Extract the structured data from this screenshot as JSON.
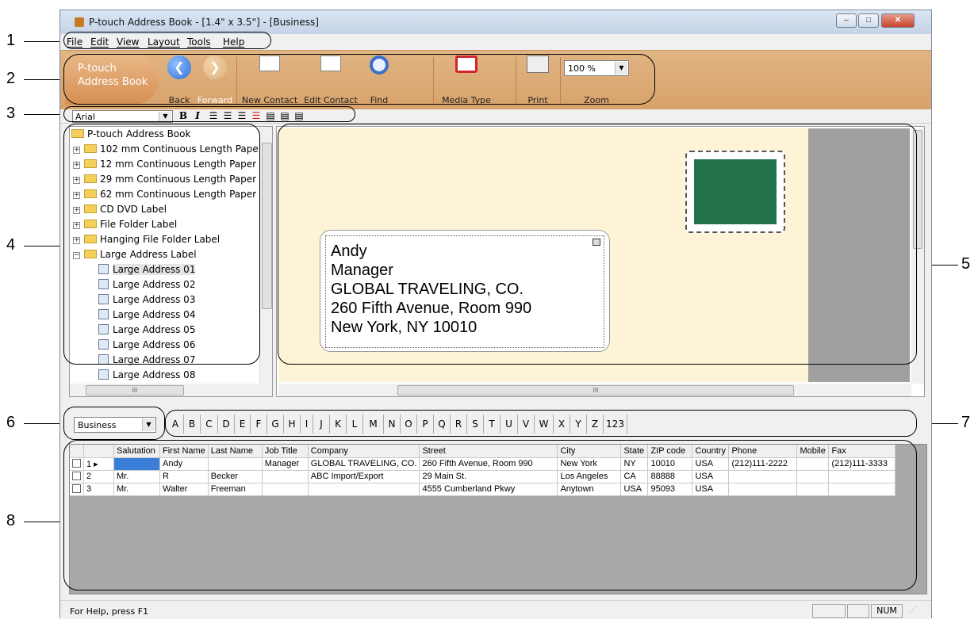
{
  "window": {
    "title": "P-touch Address Book - [1.4\" x 3.5\"] - [Business]",
    "controls": {
      "minimize": "‒",
      "maximize": "□",
      "close": "✕"
    }
  },
  "menu": [
    "File",
    "Edit",
    "View",
    "Layout",
    "Tools",
    "Help"
  ],
  "ribbon": {
    "brand_line1": "P-touch",
    "brand_line2": "Address Book",
    "back": "Back",
    "forward": "Forward",
    "new_contact": "New Contact",
    "edit_contact": "Edit Contact",
    "find": "Find",
    "media_type": "Media Type",
    "print": "Print",
    "zoom_label": "Zoom",
    "zoom_value": "100 %"
  },
  "format_bar": {
    "font": "Arial",
    "bold": "B",
    "italic": "I"
  },
  "tree": {
    "root": "P-touch Address Book",
    "folders": [
      "102 mm Continuous Length Pape",
      "12 mm Continuous Length Paper",
      "29 mm Continuous Length Paper",
      "62 mm Continuous Length Paper",
      "CD DVD Label",
      "File Folder Label",
      "Hanging File Folder Label",
      "Large Address Label"
    ],
    "items": [
      "Large Address 01",
      "Large Address 02",
      "Large Address 03",
      "Large Address 04",
      "Large Address 05",
      "Large Address 06",
      "Large Address 07",
      "Large Address 08"
    ],
    "scroll_grip": "III"
  },
  "preview": {
    "lines": [
      "Andy",
      "Manager",
      "GLOBAL TRAVELING, CO.",
      "260 Fifth Avenue, Room 990",
      "New York, NY  10010"
    ],
    "stamp_color": "#21714a",
    "scroll_grip": "III"
  },
  "group": "Business",
  "letters": [
    "A",
    "B",
    "C",
    "D",
    "E",
    "F",
    "G",
    "H",
    "I",
    "J",
    "K",
    "L",
    "M",
    "N",
    "O",
    "P",
    "Q",
    "R",
    "S",
    "T",
    "U",
    "V",
    "W",
    "X",
    "Y",
    "Z",
    "123"
  ],
  "table": {
    "headers": [
      "",
      "",
      "Salutation",
      "First Name",
      "Last Name",
      "Job Title",
      "Company",
      "Street",
      "City",
      "State",
      "ZIP code",
      "Country",
      "Phone",
      "Mobile",
      "Fax"
    ],
    "rows": [
      [
        "1",
        "",
        "Andy",
        "",
        "Manager",
        "GLOBAL TRAVELING, CO.",
        "260 Fifth Avenue, Room 990",
        "New York",
        "NY",
        "10010",
        "USA",
        "(212)111-2222",
        "",
        "(212)111-3333"
      ],
      [
        "2",
        "Mr.",
        "R",
        "Becker",
        "",
        "ABC Import/Export",
        "29 Main St.",
        "Los Angeles",
        "CA",
        "88888",
        "USA",
        "",
        "",
        ""
      ],
      [
        "3",
        "Mr.",
        "Walter",
        "Freeman",
        "",
        "",
        "4555 Cumberland Pkwy",
        "Anytown",
        "USA",
        "95093",
        "USA",
        "",
        "",
        ""
      ]
    ]
  },
  "status": {
    "help": "For Help, press F1",
    "num": "NUM"
  },
  "callouts": [
    "1",
    "2",
    "3",
    "4",
    "5",
    "6",
    "7",
    "8"
  ]
}
